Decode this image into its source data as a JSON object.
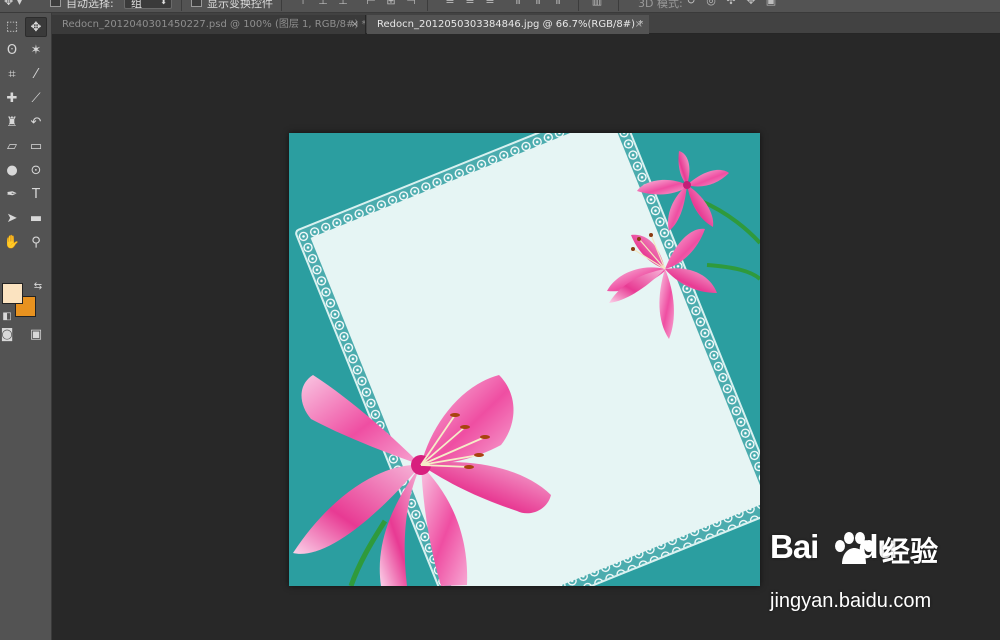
{
  "options_bar": {
    "tool_preset_icon": "move-tool-icon",
    "auto_select_label": "自动选择:",
    "auto_select_value": "组",
    "show_transform_label": "显示变换控件",
    "mode_3d_label": "3D 模式:"
  },
  "toolbox": {
    "tools": [
      {
        "name": "marquee-tool-icon",
        "glyph": "⬚"
      },
      {
        "name": "move-tool-icon",
        "glyph": "✥"
      },
      {
        "name": "lasso-tool-icon",
        "glyph": "ʘ"
      },
      {
        "name": "magic-wand-tool-icon",
        "glyph": "✶"
      },
      {
        "name": "crop-tool-icon",
        "glyph": "⌗"
      },
      {
        "name": "eyedropper-tool-icon",
        "glyph": "⁄"
      },
      {
        "name": "healing-brush-tool-icon",
        "glyph": "✚"
      },
      {
        "name": "brush-tool-icon",
        "glyph": "⟋"
      },
      {
        "name": "clone-stamp-tool-icon",
        "glyph": "♜"
      },
      {
        "name": "history-brush-tool-icon",
        "glyph": "↶"
      },
      {
        "name": "eraser-tool-icon",
        "glyph": "▱"
      },
      {
        "name": "gradient-tool-icon",
        "glyph": "▭"
      },
      {
        "name": "blur-tool-icon",
        "glyph": "●"
      },
      {
        "name": "dodge-tool-icon",
        "glyph": "⊙"
      },
      {
        "name": "pen-tool-icon",
        "glyph": "✒"
      },
      {
        "name": "type-tool-icon",
        "glyph": "T"
      },
      {
        "name": "path-selection-tool-icon",
        "glyph": "➤"
      },
      {
        "name": "rectangle-tool-icon",
        "glyph": "▬"
      },
      {
        "name": "hand-tool-icon",
        "glyph": "✋"
      },
      {
        "name": "zoom-tool-icon",
        "glyph": "⚲"
      }
    ],
    "foreground_color": "#fbe3c0",
    "background_color": "#e8921f"
  },
  "tabs": [
    {
      "label": "Redocn_2012040301450227.psd @ 100% (图层 1, RGB/8#) *",
      "active": false
    },
    {
      "label": "Redocn_2012050303384846.jpg @ 66.7%(RGB/8#) *",
      "active": true
    }
  ],
  "watermark": {
    "brand_left": "Bai",
    "brand_right": "du",
    "service": "经验",
    "url": "jingyan.baidu.com"
  },
  "colors": {
    "teal_background": "#2b9ea0",
    "paper": "#e6f5f4",
    "lily_pink": "#ec3d97"
  }
}
